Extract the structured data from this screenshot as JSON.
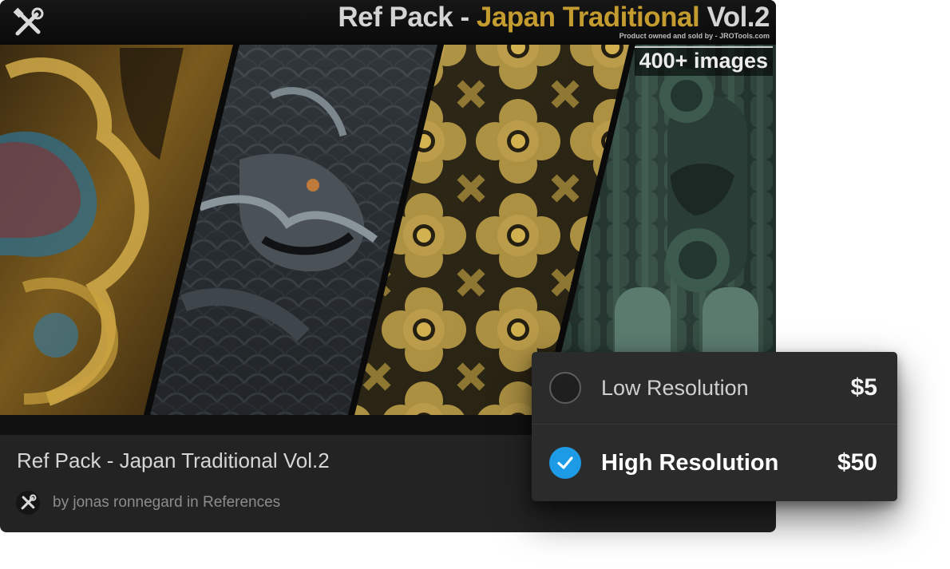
{
  "card": {
    "banner": {
      "title_part1": "Ref Pack - ",
      "title_part2": "Japan Traditional",
      "title_part3": " Vol.2",
      "subtitle": "Product owned and sold by - JROTools.com",
      "badge": "400+ images",
      "logo_icon": "tools-crossed-icon"
    },
    "title": "Ref Pack - Japan Traditional Vol.2",
    "byline": "by jonas ronnegard in References",
    "avatar_icon": "tools-crossed-icon"
  },
  "selector": {
    "options": [
      {
        "label": "Low Resolution",
        "price": "$5",
        "selected": false
      },
      {
        "label": "High Resolution",
        "price": "$50",
        "selected": true
      }
    ],
    "check_icon": "checkmark-icon"
  },
  "colors": {
    "accent": "#1e9be6",
    "gold": "#c49b2e",
    "card_bg": "#232323",
    "panel_bg": "#2b2b2b"
  }
}
